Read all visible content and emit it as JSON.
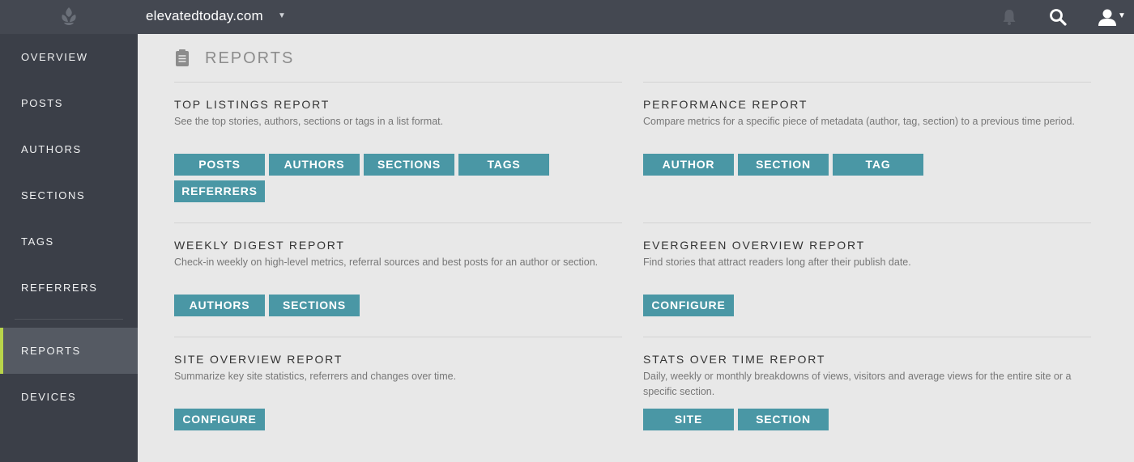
{
  "header": {
    "logo_icon": "leaf-logo-icon",
    "site_name": "elevatedtoday.com",
    "site_caret": "▼",
    "user_caret": "▼",
    "icons": [
      "bell-icon",
      "search-icon",
      "user-icon"
    ]
  },
  "sidebar": {
    "items": [
      {
        "label": "OVERVIEW"
      },
      {
        "label": "POSTS"
      },
      {
        "label": "AUTHORS"
      },
      {
        "label": "SECTIONS"
      },
      {
        "label": "TAGS"
      },
      {
        "label": "REFERRERS"
      },
      {
        "label": "REPORTS",
        "active": true
      },
      {
        "label": "DEVICES"
      }
    ],
    "active_accent": "#b8d44a"
  },
  "main": {
    "page_title": "REPORTS",
    "page_icon": "clipboard-icon",
    "reports": [
      {
        "title": "TOP LISTINGS REPORT",
        "description": "See the top stories, authors, sections or tags in a list format.",
        "buttons": [
          "POSTS",
          "AUTHORS",
          "SECTIONS",
          "TAGS",
          "REFERRERS"
        ]
      },
      {
        "title": "PERFORMANCE REPORT",
        "description": "Compare metrics for a specific piece of metadata (author, tag, section) to a previous time period.",
        "buttons": [
          "AUTHOR",
          "SECTION",
          "TAG"
        ]
      },
      {
        "title": "WEEKLY DIGEST REPORT",
        "description": "Check-in weekly on high-level metrics, referral sources and best posts for an author or section.",
        "buttons": [
          "AUTHORS",
          "SECTIONS"
        ]
      },
      {
        "title": "EVERGREEN OVERVIEW REPORT",
        "description": "Find stories that attract readers long after their publish date.",
        "buttons": [
          "CONFIGURE"
        ]
      },
      {
        "title": "SITE OVERVIEW REPORT",
        "description": "Summarize key site statistics, referrers and changes over time.",
        "buttons": [
          "CONFIGURE"
        ]
      },
      {
        "title": "STATS OVER TIME REPORT",
        "description": "Daily, weekly or monthly breakdowns of views, visitors and average views for the entire site or a specific section.",
        "buttons": [
          "SITE",
          "SECTION"
        ]
      }
    ],
    "button_color": "#4a97a5"
  }
}
